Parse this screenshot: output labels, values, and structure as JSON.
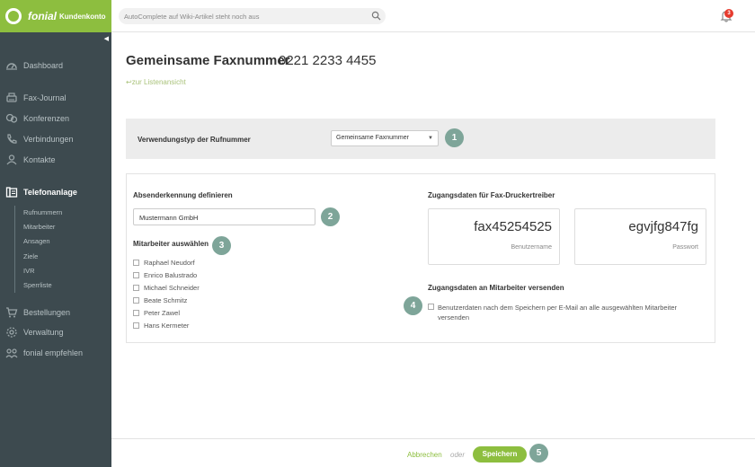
{
  "brand": {
    "name": "fonial",
    "sub": "Kundenkonto"
  },
  "search": {
    "placeholder": "AutoComplete auf Wiki-Artikel steht noch aus"
  },
  "notifications": {
    "count": "3"
  },
  "sidebar": {
    "items": [
      {
        "label": "Dashboard",
        "icon": "dashboard-icon"
      },
      {
        "label": "Fax-Journal",
        "icon": "fax-icon"
      },
      {
        "label": "Konferenzen",
        "icon": "conference-icon"
      },
      {
        "label": "Verbindungen",
        "icon": "phone-icon"
      },
      {
        "label": "Kontakte",
        "icon": "contacts-icon"
      },
      {
        "label": "Telefonanlage",
        "icon": "pbx-icon",
        "active": true
      },
      {
        "label": "Bestellungen",
        "icon": "cart-icon"
      },
      {
        "label": "Verwaltung",
        "icon": "settings-icon"
      },
      {
        "label": "fonial empfehlen",
        "icon": "recommend-icon"
      }
    ],
    "subitems": [
      "Rufnummern",
      "Mitarbeiter",
      "Ansagen",
      "Ziele",
      "IVR",
      "Sperrliste"
    ]
  },
  "page": {
    "title": "Gemeinsame Faxnummer",
    "number": "0221 2233 4455",
    "back_link": "zur Listenansicht"
  },
  "usage": {
    "label": "Verwendungstyp der Rufnummer",
    "selected": "Gemeinsame Faxnummer"
  },
  "sender": {
    "label": "Absenderkennung definieren",
    "value": "Mustermann GmbH"
  },
  "employees": {
    "label": "Mitarbeiter auswählen",
    "list": [
      "Raphael Neudorf",
      "Enrico Balustrado",
      "Michael Schneider",
      "Beate Schmitz",
      "Peter Zawel",
      "Hans Kermeter"
    ]
  },
  "fax_driver": {
    "label": "Zugangsdaten für Fax-Druckertreiber",
    "username": "fax45254525",
    "username_label": "Benutzername",
    "password": "egvjfg847fg",
    "password_label": "Passwort"
  },
  "send": {
    "label": "Zugangsdaten an Mitarbeiter versenden",
    "checkbox_text": "Benutzerdaten nach dem Speichern per E-Mail an alle ausgewählten Mitarbeiter versenden"
  },
  "steps": [
    "1",
    "2",
    "3",
    "4",
    "5"
  ],
  "footer": {
    "cancel": "Abbrechen",
    "or": "oder",
    "save": "Speichern"
  },
  "colors": {
    "brand_green": "#8dbe3f",
    "sidebar_bg": "#3d4a4f",
    "step_teal": "#7ea599",
    "badge_red": "#e63b2e"
  }
}
